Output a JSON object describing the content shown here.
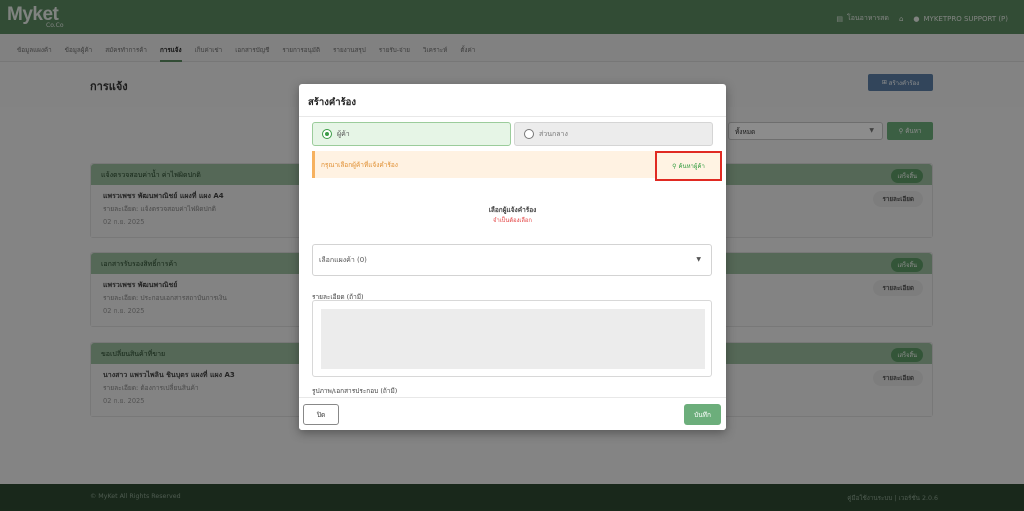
{
  "app": {
    "logo": "Myket",
    "logo_sub": "Co.Co"
  },
  "topbar": {
    "item1": "โอนอาหารสด",
    "home_icon": "⌂",
    "user": "MYKETPRO SUPPORT (P)"
  },
  "nav": [
    "ข้อมูลแผงค้า",
    "ข้อมูลผู้ค้า",
    "สมัครทำการค้า",
    "การแจ้ง",
    "เก็บค่าเช่า",
    "เอกสารบัญชี",
    "รายการอนุมัติ",
    "รายงานสรุป",
    "รายรับ-จ่าย",
    "วิเคราะห์",
    "ตั้งค่า"
  ],
  "page": {
    "title": "การแจ้ง",
    "create_label": "สร้างคำร้อง"
  },
  "filter": {
    "value": "ทั้งหมด",
    "search_label": "ค้นหา"
  },
  "cards": [
    {
      "title": "แจ้งตรวจสอบค่าน้ำ ค่าไฟผิดปกติ",
      "badge": "เสร็จสิ้น",
      "name": "แพรวเพชร พัฒนพาณิชย์ แผงที่ แผง A4",
      "detail": "รายละเอียด: แจ้งตรวจสอบค่าไฟผิดปกติ",
      "date": "02 ก.ย. 2025",
      "detail_btn": "รายละเอียด"
    },
    {
      "title": "เอกสารรับรองสิทธิ์การค้า",
      "badge": "เสร็จสิ้น",
      "name": "แพรวเพชร พัฒนพาณิชย์",
      "detail": "รายละเอียด: ประกอบเอกสารสถาบันการเงิน",
      "date": "02 ก.ย. 2025",
      "detail_btn": "รายละเอียด"
    },
    {
      "title": "ขอเปลี่ยนสินค้าที่ขาย",
      "badge": "เสร็จสิ้น",
      "name": "นางสาว แพรวไพลิน ชินบุตร แผงที่ แผง A3",
      "detail": "รายละเอียด: ต้องการเปลี่ยนสินค้า",
      "date": "02 ก.ย. 2025",
      "detail_btn": "รายละเอียด"
    }
  ],
  "footer": {
    "left": "© MyKet All Rights Reserved",
    "right": "คู่มือใช้งานระบบ | เวอร์ชั่น 2.0.6"
  },
  "modal": {
    "title": "สร้างคำร้อง",
    "radio1": "ผู้ค้า",
    "radio2": "ส่วนกลาง",
    "warning": "กรุณาเลือกผู้ค้าที่แจ้งคำร้อง",
    "find_label": "ค้นหาผู้ค้า",
    "choose_label": "เลือกผู้แจ้งคำร้อง",
    "required": "จำเป็นต้องเลือก",
    "select_stall": "เลือกแผงค้า (0)",
    "detail_label": "รายละเอียด (ถ้ามี)",
    "attach_label": "รูปภาพ/เอกสารประกอบ (ถ้ามี)",
    "close_label": "ปิด",
    "save_label": "บันทึก"
  },
  "colors": {
    "primary": "#5c8a62",
    "button": "#6cae7b",
    "highlight": "#e02a22",
    "warning_bg": "#fff2e2"
  }
}
